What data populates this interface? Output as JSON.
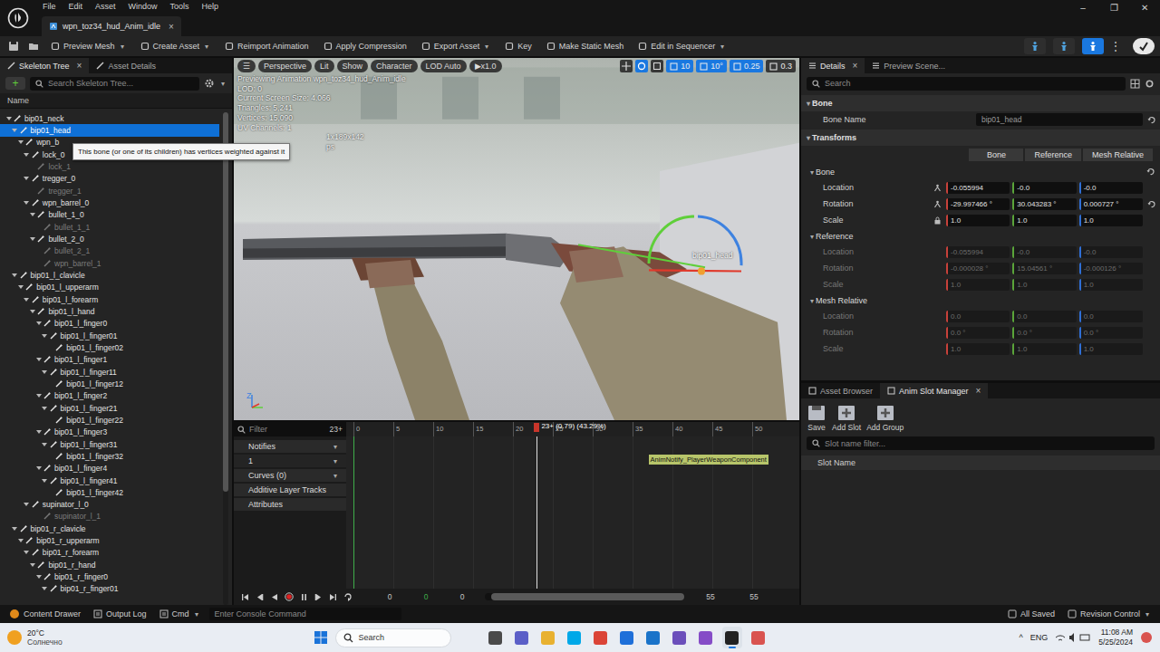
{
  "window": {
    "menu": [
      "File",
      "Edit",
      "Asset",
      "Window",
      "Tools",
      "Help"
    ],
    "tab": {
      "label": "wpn_toz34_hud_Anim_idle",
      "close": "×"
    },
    "controls": [
      "–",
      "❐",
      "✕"
    ]
  },
  "caret": "▾",
  "toolbar": {
    "buttons": [
      {
        "label": "Preview Mesh",
        "dropdown": true
      },
      {
        "label": "Create Asset",
        "dropdown": true
      },
      {
        "label": "Reimport Animation",
        "dropdown": false
      },
      {
        "label": "Apply Compression",
        "dropdown": false
      },
      {
        "label": "Export Asset",
        "dropdown": true
      },
      {
        "label": "Key",
        "dropdown": false
      },
      {
        "label": "Make Static Mesh",
        "dropdown": false
      },
      {
        "label": "Edit in Sequencer",
        "dropdown": true
      }
    ],
    "more": "⋮",
    "modes": [
      {
        "selected": false
      },
      {
        "selected": false
      },
      {
        "selected": true
      }
    ]
  },
  "skeleton": {
    "tabs": [
      {
        "label": "Skeleton Tree",
        "selected": true,
        "close": "×"
      },
      {
        "label": "Asset Details",
        "selected": false,
        "close": ""
      }
    ],
    "add": "+",
    "search": "Search Skeleton Tree...",
    "column": "Name",
    "scrollbar": {
      "level": 0.77
    },
    "bones": [
      {
        "name": "bip01_neck",
        "depth": 0,
        "expanded": true,
        "weighted": true,
        "selected": false
      },
      {
        "name": "bip01_head",
        "depth": 1,
        "expanded": true,
        "weighted": true,
        "selected": true
      },
      {
        "name": "wpn_b",
        "depth": 2,
        "expanded": true,
        "weighted": true,
        "selected": false
      },
      {
        "name": "lock_0",
        "depth": 3,
        "expanded": true,
        "weighted": true,
        "selected": false
      },
      {
        "name": "lock_1",
        "depth": 4,
        "expanded": false,
        "weighted": false,
        "selected": false
      },
      {
        "name": "tregger_0",
        "depth": 3,
        "expanded": true,
        "weighted": true,
        "selected": false
      },
      {
        "name": "tregger_1",
        "depth": 4,
        "expanded": false,
        "weighted": false,
        "selected": false
      },
      {
        "name": "wpn_barrel_0",
        "depth": 3,
        "expanded": true,
        "weighted": true,
        "selected": false
      },
      {
        "name": "bullet_1_0",
        "depth": 4,
        "expanded": true,
        "weighted": true,
        "selected": false
      },
      {
        "name": "bullet_1_1",
        "depth": 5,
        "expanded": false,
        "weighted": false,
        "selected": false
      },
      {
        "name": "bullet_2_0",
        "depth": 4,
        "expanded": true,
        "weighted": true,
        "selected": false
      },
      {
        "name": "bullet_2_1",
        "depth": 5,
        "expanded": false,
        "weighted": false,
        "selected": false
      },
      {
        "name": "wpn_barrel_1",
        "depth": 5,
        "expanded": false,
        "weighted": false,
        "selected": false
      },
      {
        "name": "bip01_l_clavicle",
        "depth": 1,
        "expanded": true,
        "weighted": true,
        "selected": false
      },
      {
        "name": "bip01_l_upperarm",
        "depth": 2,
        "expanded": true,
        "weighted": true,
        "selected": false
      },
      {
        "name": "bip01_l_forearm",
        "depth": 3,
        "expanded": true,
        "weighted": true,
        "selected": false
      },
      {
        "name": "bip01_l_hand",
        "depth": 4,
        "expanded": true,
        "weighted": true,
        "selected": false
      },
      {
        "name": "bip01_l_finger0",
        "depth": 5,
        "expanded": true,
        "weighted": true,
        "selected": false
      },
      {
        "name": "bip01_l_finger01",
        "depth": 6,
        "expanded": true,
        "weighted": true,
        "selected": false
      },
      {
        "name": "bip01_l_finger02",
        "depth": 7,
        "expanded": false,
        "weighted": true,
        "selected": false
      },
      {
        "name": "bip01_l_finger1",
        "depth": 5,
        "expanded": true,
        "weighted": true,
        "selected": false
      },
      {
        "name": "bip01_l_finger11",
        "depth": 6,
        "expanded": true,
        "weighted": true,
        "selected": false
      },
      {
        "name": "bip01_l_finger12",
        "depth": 7,
        "expanded": false,
        "weighted": true,
        "selected": false
      },
      {
        "name": "bip01_l_finger2",
        "depth": 5,
        "expanded": true,
        "weighted": true,
        "selected": false
      },
      {
        "name": "bip01_l_finger21",
        "depth": 6,
        "expanded": true,
        "weighted": true,
        "selected": false
      },
      {
        "name": "bip01_l_finger22",
        "depth": 7,
        "expanded": false,
        "weighted": true,
        "selected": false
      },
      {
        "name": "bip01_l_finger3",
        "depth": 5,
        "expanded": true,
        "weighted": true,
        "selected": false
      },
      {
        "name": "bip01_l_finger31",
        "depth": 6,
        "expanded": true,
        "weighted": true,
        "selected": false
      },
      {
        "name": "bip01_l_finger32",
        "depth": 7,
        "expanded": false,
        "weighted": true,
        "selected": false
      },
      {
        "name": "bip01_l_finger4",
        "depth": 5,
        "expanded": true,
        "weighted": true,
        "selected": false
      },
      {
        "name": "bip01_l_finger41",
        "depth": 6,
        "expanded": true,
        "weighted": true,
        "selected": false
      },
      {
        "name": "bip01_l_finger42",
        "depth": 7,
        "expanded": false,
        "weighted": true,
        "selected": false
      },
      {
        "name": "supinator_l_0",
        "depth": 3,
        "expanded": true,
        "weighted": true,
        "selected": false
      },
      {
        "name": "supinator_l_1",
        "depth": 5,
        "expanded": false,
        "weighted": false,
        "selected": false
      },
      {
        "name": "bip01_r_clavicle",
        "depth": 1,
        "expanded": true,
        "weighted": true,
        "selected": false
      },
      {
        "name": "bip01_r_upperarm",
        "depth": 2,
        "expanded": true,
        "weighted": true,
        "selected": false
      },
      {
        "name": "bip01_r_forearm",
        "depth": 3,
        "expanded": true,
        "weighted": true,
        "selected": false
      },
      {
        "name": "bip01_r_hand",
        "depth": 4,
        "expanded": true,
        "weighted": true,
        "selected": false
      },
      {
        "name": "bip01_r_finger0",
        "depth": 5,
        "expanded": true,
        "weighted": true,
        "selected": false
      },
      {
        "name": "bip01_r_finger01",
        "depth": 6,
        "expanded": true,
        "weighted": true,
        "selected": false
      }
    ]
  },
  "tooltip": "This bone (or one of its children) has vertices weighted against it",
  "viewport": {
    "menu": "☰",
    "left_buttons": [
      "Perspective",
      "Lit",
      "Show",
      "Character",
      "LOD Auto",
      "x1.0"
    ],
    "play": "▶",
    "right_values": [
      "10",
      "10°",
      "0.25",
      "0.3"
    ],
    "stats": [
      {
        "text": "Previewing Animation wpn_toz34_hud_Anim_idle",
        "kind": "full"
      },
      {
        "text": "LOD: 0",
        "kind": "full"
      },
      {
        "text": "Current Screen Size: 4.066",
        "kind": "full"
      },
      {
        "text": "Triangles: 5,241",
        "kind": "full"
      },
      {
        "text": "Vertices: 15,090",
        "kind": "full"
      },
      {
        "text": "UV Channels: 1",
        "kind": "full"
      },
      {
        "text": "1x189x142",
        "kind": "partial"
      },
      {
        "text": "ps",
        "kind": "partial"
      }
    ],
    "bone_label": "bip01_head",
    "axis": "Z"
  },
  "timeline": {
    "filter": "Filter",
    "count": "23+",
    "tracks": [
      {
        "label": "Notifies",
        "dropdown": true,
        "kind": "header"
      },
      {
        "label": "1",
        "dropdown": true,
        "kind": "track"
      },
      {
        "label": "Curves (0)",
        "dropdown": true,
        "kind": "header"
      },
      {
        "label": "Additive Layer Tracks",
        "dropdown": false,
        "kind": "header"
      },
      {
        "label": "Attributes",
        "dropdown": false,
        "kind": "header"
      }
    ],
    "ticks": [
      "0",
      "5",
      "10",
      "15",
      "20",
      "25",
      "30",
      "35",
      "40",
      "45",
      "50"
    ],
    "playhead": {
      "frame": 23,
      "label": "23+ (0.79) (43.29%)"
    },
    "notify": {
      "label": "AnimNotify_PlayerWeaponComponent",
      "frame": 37
    },
    "transport": {
      "left": [
        {
          "text": "0",
          "color": "#c8c8c8"
        },
        {
          "text": "0",
          "color": "#3fae4a"
        },
        {
          "text": "0",
          "color": "#c8c8c8"
        }
      ],
      "right": [
        {
          "text": "55",
          "color": "#c8c8c8"
        },
        {
          "text": "55",
          "color": "#c8c8c8"
        }
      ],
      "scroll": {
        "level": 0.97
      }
    }
  },
  "details": {
    "tabs": [
      {
        "label": "Details",
        "selected": true,
        "close": "×"
      },
      {
        "label": "Preview Scene...",
        "selected": false,
        "close": ""
      }
    ],
    "search": "Search",
    "bone_section": "Bone",
    "bone_name_label": "Bone Name",
    "bone_name": "bip01_head",
    "transforms_section": "Transforms",
    "transform_buttons": [
      "Bone",
      "Reference",
      "Mesh Relative"
    ],
    "groups": [
      {
        "title": "Bone",
        "disabled": false,
        "reset": true,
        "rows": [
          {
            "label": "Location",
            "icon": "space",
            "reset": false,
            "values": [
              "-0.055994",
              "-0.0",
              "-0.0"
            ]
          },
          {
            "label": "Rotation",
            "icon": "space",
            "reset": true,
            "values": [
              "-29.997466 °",
              "30.043283 °",
              "0.000727 °"
            ]
          },
          {
            "label": "Scale",
            "icon": "lock",
            "reset": false,
            "values": [
              "1.0",
              "1.0",
              "1.0"
            ]
          }
        ]
      },
      {
        "title": "Reference",
        "disabled": true,
        "reset": false,
        "rows": [
          {
            "label": "Location",
            "icon": "space",
            "reset": false,
            "values": [
              "-0.055994",
              "-0.0",
              "-0.0"
            ]
          },
          {
            "label": "Rotation",
            "icon": "space",
            "reset": false,
            "values": [
              "-0.000028 °",
              "15.04561 °",
              "-0.000126 °"
            ]
          },
          {
            "label": "Scale",
            "icon": "space",
            "reset": false,
            "values": [
              "1.0",
              "1.0",
              "1.0"
            ]
          }
        ]
      },
      {
        "title": "Mesh Relative",
        "disabled": true,
        "reset": false,
        "rows": [
          {
            "label": "Location",
            "icon": "space",
            "reset": false,
            "values": [
              "0.0",
              "0.0",
              "0.0"
            ]
          },
          {
            "label": "Rotation",
            "icon": "space",
            "reset": false,
            "values": [
              "0.0 °",
              "0.0 °",
              "0.0 °"
            ]
          },
          {
            "label": "Scale",
            "icon": "space",
            "reset": false,
            "values": [
              "1.0",
              "1.0",
              "1.0"
            ]
          }
        ]
      }
    ]
  },
  "slots": {
    "tabs": [
      {
        "label": "Asset Browser",
        "selected": false,
        "close": ""
      },
      {
        "label": "Anim Slot Manager",
        "selected": true,
        "close": "×"
      }
    ],
    "buttons": [
      "Save",
      "Add Slot",
      "Add Group"
    ],
    "filter": "Slot name filter...",
    "column": "Slot Name"
  },
  "status_bar": {
    "left": [
      {
        "label": "Content Drawer",
        "dropdown": false
      },
      {
        "label": "Output Log",
        "dropdown": false
      },
      {
        "label": "Cmd",
        "dropdown": true
      }
    ],
    "console": "Enter Console Command",
    "right": [
      "All Saved",
      "Revision Control"
    ]
  },
  "taskbar": {
    "temperature": "20°C",
    "condition": "Солнечно",
    "search": "Search",
    "apps": [
      {
        "color": "#4a4a4a",
        "selected": false
      },
      {
        "color": "#5b5fc7",
        "selected": false
      },
      {
        "color": "#e8b130",
        "selected": false
      },
      {
        "color": "#00a8e8",
        "selected": false
      },
      {
        "color": "#db4437",
        "selected": false
      },
      {
        "color": "#1e6fd9",
        "selected": false
      },
      {
        "color": "#1a73c9",
        "selected": false
      },
      {
        "color": "#6b4fbb",
        "selected": false
      },
      {
        "color": "#854cc7",
        "selected": false
      },
      {
        "color": "#222222",
        "selected": true
      },
      {
        "color": "#d9534f",
        "selected": false
      }
    ],
    "tray_chevron": "^",
    "language": "ENG",
    "time": "11:08 AM",
    "date": "5/25/2024"
  }
}
